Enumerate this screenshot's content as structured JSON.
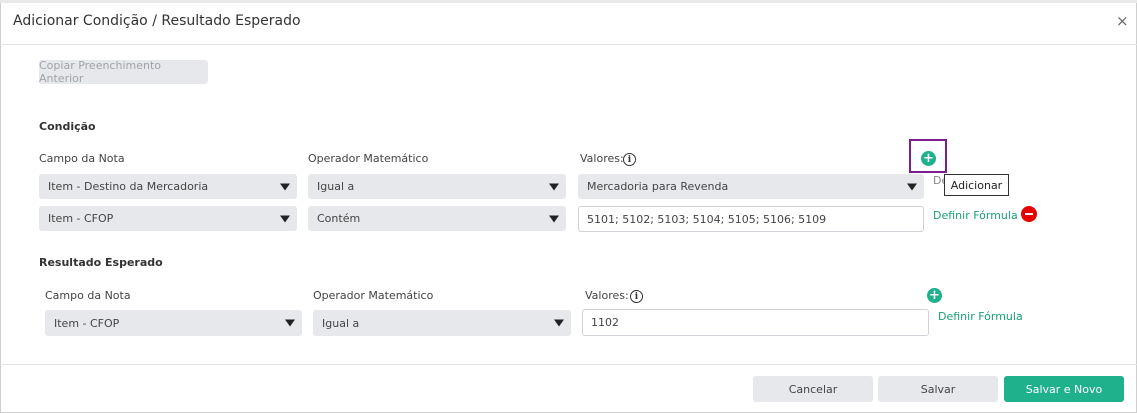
{
  "modal": {
    "title": "Adicionar Condição / Resultado Esperado",
    "close_glyph": "×",
    "copy_button": "Copiar Preenchimento Anterior"
  },
  "condition": {
    "section_title": "Condição",
    "labels": {
      "field": "Campo da Nota",
      "operator": "Operador Matemático",
      "values": "Valores:"
    },
    "rows": [
      {
        "field": "Item - Destino da Mercadoria",
        "operator": "Igual a",
        "value": "Mercadoria para Revenda",
        "formula_link": "De"
      },
      {
        "field": "Item - CFOP",
        "operator": "Contém",
        "value": "5101; 5102; 5103; 5104; 5105; 5106; 5109",
        "formula_link": "Definir Fórmula"
      }
    ],
    "tooltip": "Adicionar"
  },
  "result": {
    "section_title": "Resultado Esperado",
    "labels": {
      "field": "Campo da Nota",
      "operator": "Operador Matemático",
      "values": "Valores:"
    },
    "row": {
      "field": "Item - CFOP",
      "operator": "Igual a",
      "value": "1102",
      "formula_link": "Definir Fórmula"
    }
  },
  "footer": {
    "cancel": "Cancelar",
    "save": "Salvar",
    "save_new": "Salvar e Novo"
  },
  "icons": {
    "info": "i",
    "plus": "+"
  },
  "colors": {
    "accent": "#1fb08c",
    "danger": "#e60000",
    "highlight": "#7a1f8c"
  }
}
